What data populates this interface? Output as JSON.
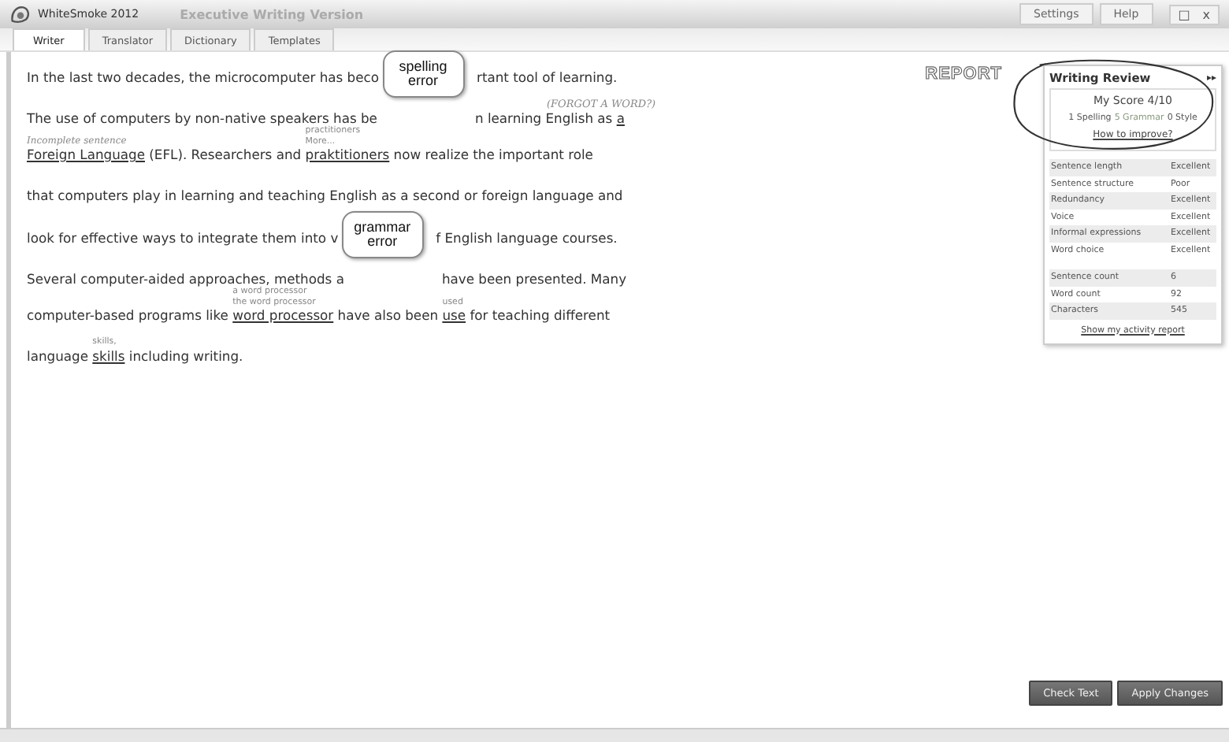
{
  "window": {
    "app_name": "WhiteSmoke 2012",
    "edition": "Executive Writing Version",
    "buttons": [
      "Settings",
      "Help"
    ],
    "controls": [
      "□",
      "x"
    ]
  },
  "tabs": [
    {
      "label": "Writer",
      "selected": true
    },
    {
      "label": "Translator",
      "selected": false
    },
    {
      "label": "Dictionary",
      "selected": false
    },
    {
      "label": "Templates",
      "selected": false
    }
  ],
  "document": {
    "lines": [
      {
        "segments": [
          {
            "kind": "text",
            "text": "In the last two decades, the microcomputer has beco"
          },
          {
            "kind": "covered",
            "callout": "spelling error"
          },
          {
            "kind": "text",
            "text": "rtant tool of learning."
          }
        ]
      },
      {
        "side_note": "(FORGOT A WORD?)",
        "segments": [
          {
            "kind": "text",
            "text": "The use of computers by non-native speakers has be"
          },
          {
            "kind": "covered"
          },
          {
            "kind": "text",
            "text": "n learning English as "
          },
          {
            "kind": "error",
            "text": "a"
          }
        ]
      },
      {
        "segments": [
          {
            "kind": "error",
            "text": "Foreign Language",
            "note": "Incomplete sentence"
          },
          {
            "kind": "text",
            "text": " (EFL). Researchers and "
          },
          {
            "kind": "error",
            "text": "praktitioners",
            "suggestions": [
              "practitioners",
              "More..."
            ]
          },
          {
            "kind": "text",
            "text": " now realize the important role"
          }
        ]
      },
      {
        "segments": [
          {
            "kind": "text",
            "text": "that computers play in learning and teaching English as a second or foreign language and"
          }
        ]
      },
      {
        "segments": [
          {
            "kind": "text",
            "text": "look for effective ways to integrate them into v"
          },
          {
            "kind": "covered",
            "callout": "grammar error"
          },
          {
            "kind": "text",
            "text": "f English language courses."
          }
        ]
      },
      {
        "segments": [
          {
            "kind": "text",
            "text": "Several computer-aided approaches, methods a"
          },
          {
            "kind": "covered"
          },
          {
            "kind": "text",
            "text": "have been presented. Many"
          }
        ]
      },
      {
        "segments": [
          {
            "kind": "text",
            "text": "computer-based programs like "
          },
          {
            "kind": "error",
            "text": "word processor",
            "suggestions": [
              "a word processor",
              "the word processor"
            ]
          },
          {
            "kind": "text",
            "text": " have also been "
          },
          {
            "kind": "error",
            "text": "use",
            "suggestions": [
              "used"
            ]
          },
          {
            "kind": "text",
            "text": " for teaching different"
          }
        ]
      },
      {
        "segments": [
          {
            "kind": "text",
            "text": "language "
          },
          {
            "kind": "error",
            "text": "skills",
            "suggestions": [
              "skills,"
            ]
          },
          {
            "kind": "text",
            "text": " including writing."
          }
        ]
      }
    ]
  },
  "report_label": "REPORT",
  "review": {
    "title": "Writing Review",
    "collapse": "▸▸",
    "score": "My Score 4/10",
    "tally": [
      {
        "text": "1 Spelling",
        "color": "#555555"
      },
      {
        "text": "5 Grammar",
        "color": "#8a9a80"
      },
      {
        "text": "0 Style",
        "color": "#555555"
      }
    ],
    "improve_link": "How to improve?",
    "ratings": [
      {
        "label": "Sentence length",
        "value": "Excellent"
      },
      {
        "label": "Sentence structure",
        "value": "Poor"
      },
      {
        "label": "Redundancy",
        "value": "Excellent"
      },
      {
        "label": "Voice",
        "value": "Excellent"
      },
      {
        "label": "Informal expressions",
        "value": "Excellent"
      },
      {
        "label": "Word choice",
        "value": "Excellent"
      }
    ],
    "stats": [
      {
        "label": "Sentence count",
        "value": "6"
      },
      {
        "label": "Word count",
        "value": "92"
      },
      {
        "label": "Characters",
        "value": "545"
      }
    ],
    "activity_link": "Show my activity report"
  },
  "actions": [
    "Check Text",
    "Apply Changes"
  ]
}
